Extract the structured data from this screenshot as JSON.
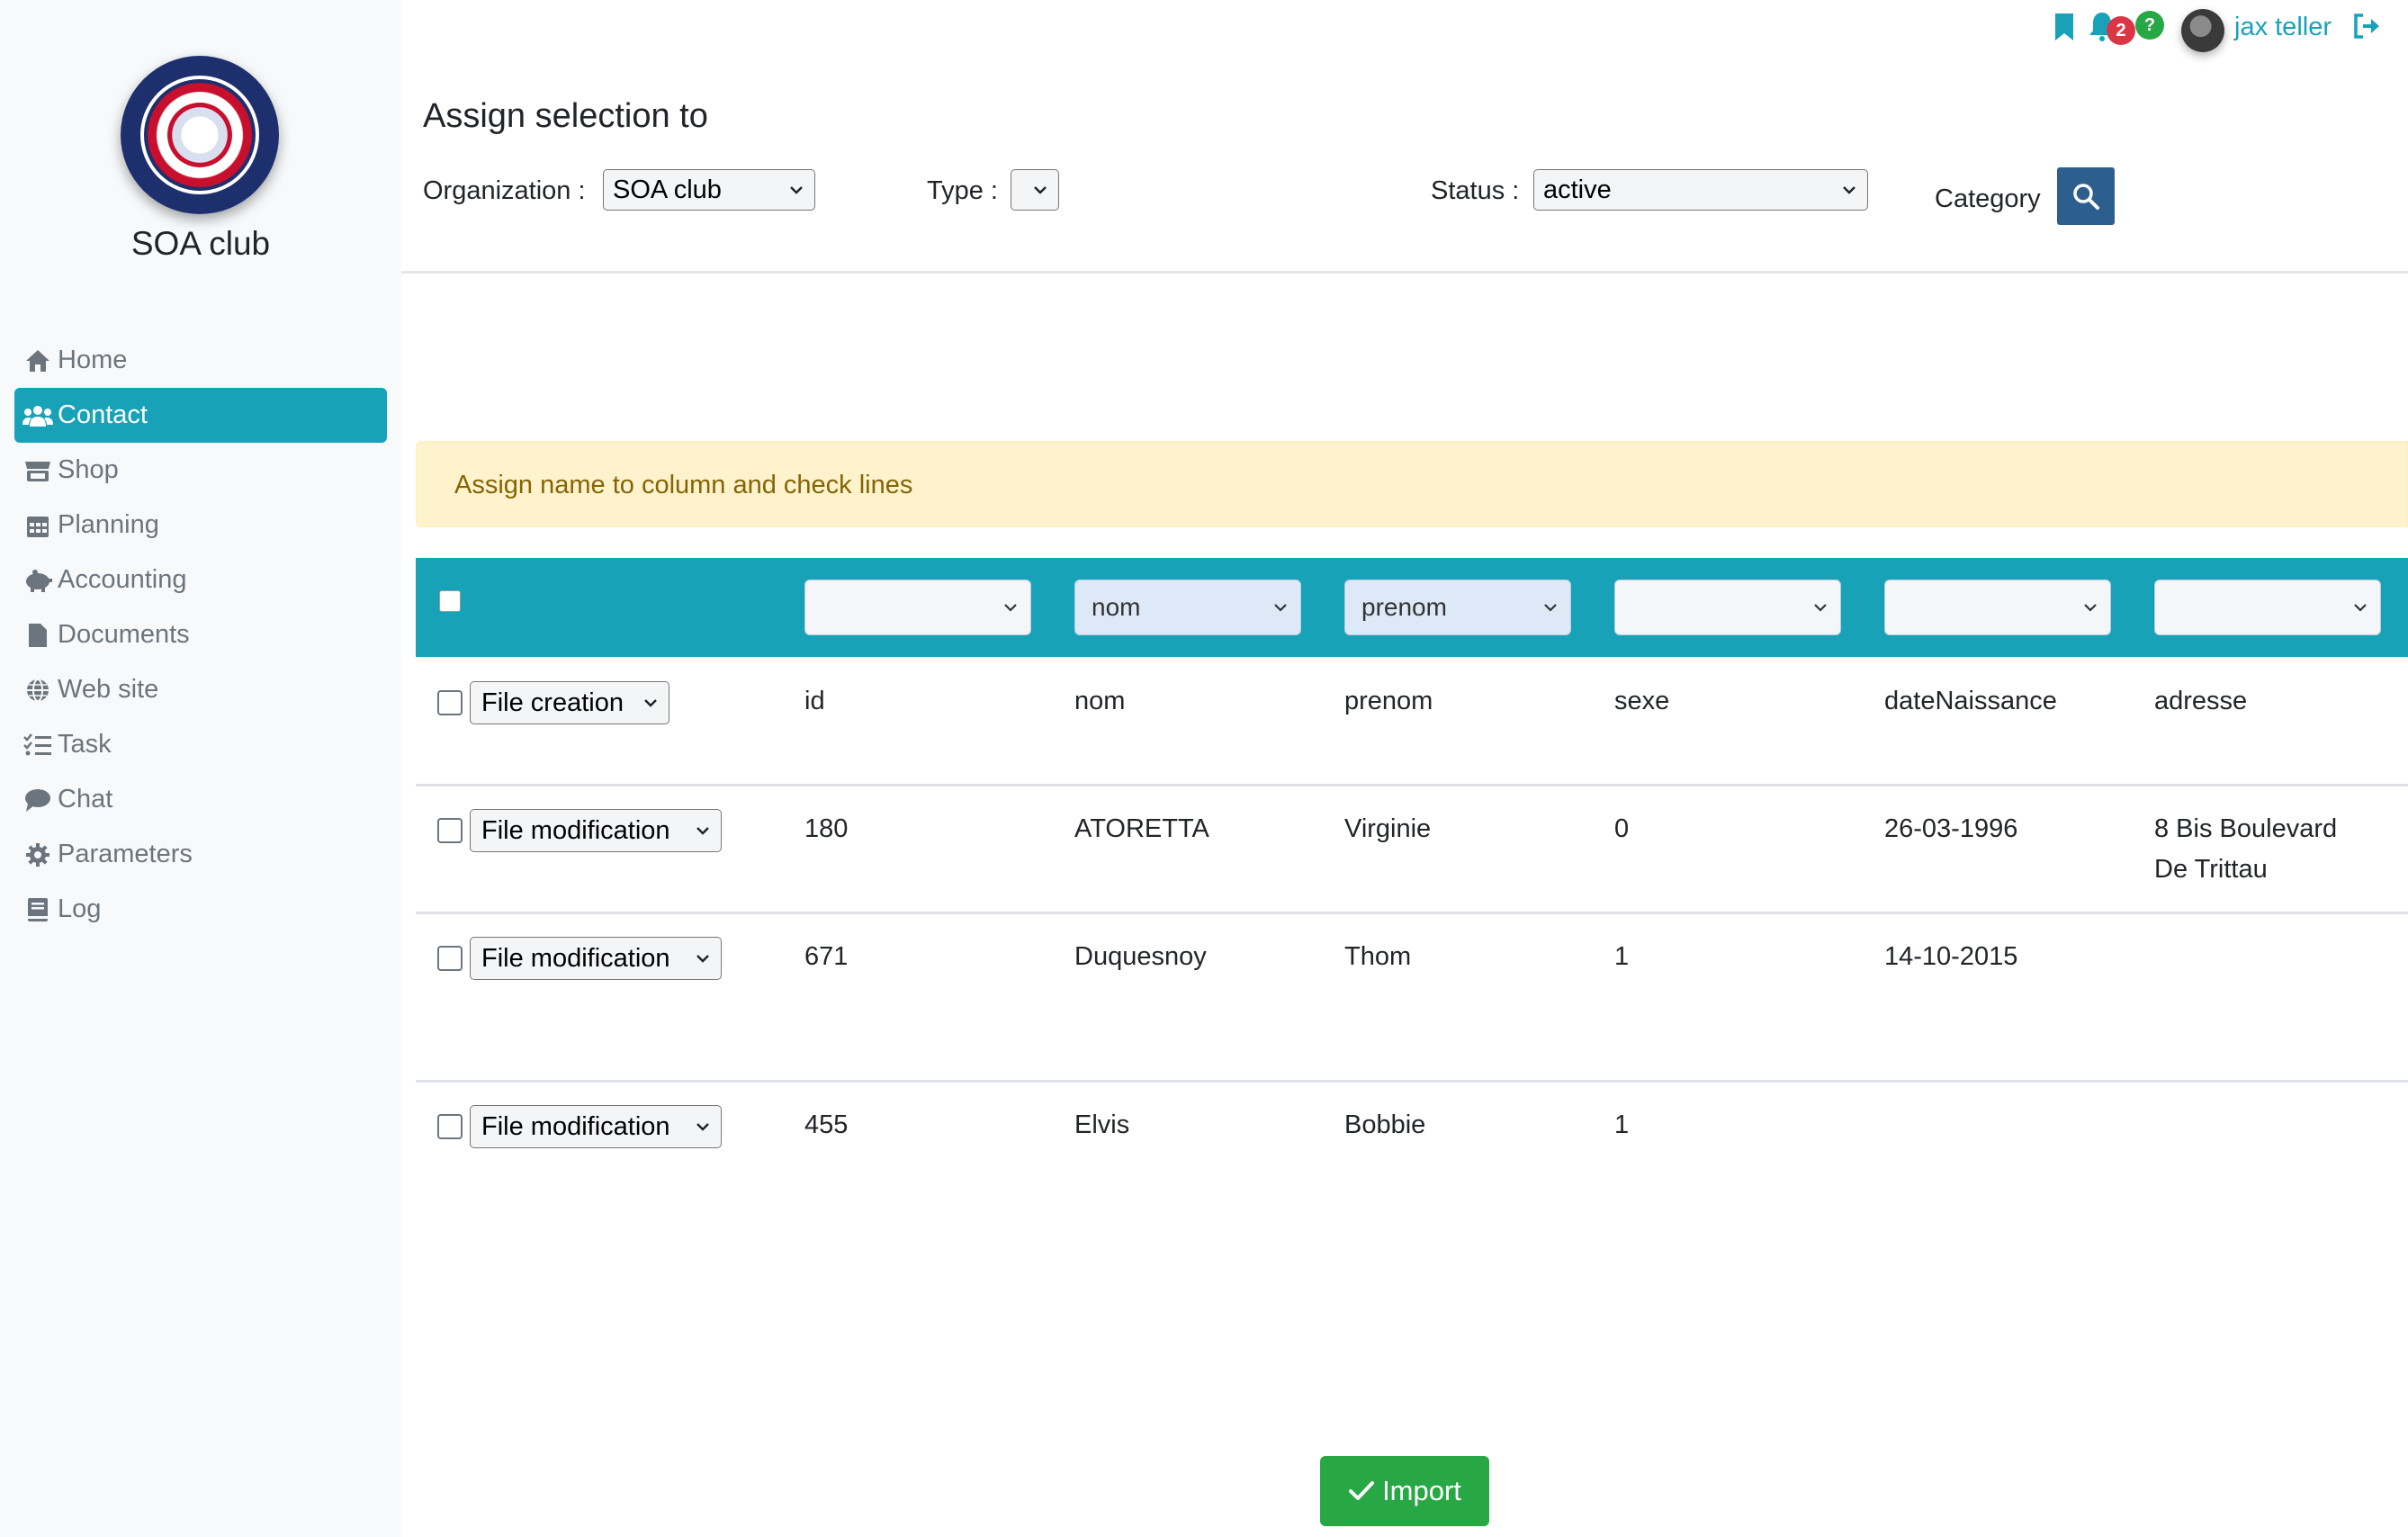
{
  "sidebar": {
    "org_name": "SOA club",
    "items": [
      {
        "label": "Home",
        "icon": "home-icon"
      },
      {
        "label": "Contact",
        "icon": "users-icon",
        "active": true
      },
      {
        "label": "Shop",
        "icon": "store-icon"
      },
      {
        "label": "Planning",
        "icon": "calendar-icon"
      },
      {
        "label": "Accounting",
        "icon": "piggy-bank-icon"
      },
      {
        "label": "Documents",
        "icon": "file-icon"
      },
      {
        "label": "Web site",
        "icon": "globe-icon"
      },
      {
        "label": "Task",
        "icon": "tasks-icon"
      },
      {
        "label": "Chat",
        "icon": "comment-icon"
      },
      {
        "label": "Parameters",
        "icon": "gear-icon"
      },
      {
        "label": "Log",
        "icon": "book-icon"
      }
    ]
  },
  "topbar": {
    "notification_count": "2",
    "help_label": "?",
    "user_name": "jax teller"
  },
  "header": {
    "title": "Assign selection to",
    "organization_label": "Organization :",
    "organization_value": "SOA club",
    "type_label": "Type :",
    "type_value": "",
    "status_label": "Status :",
    "status_value": "active",
    "category_label": "Category"
  },
  "alert": {
    "message": "Assign name to column and check lines"
  },
  "table": {
    "column_selects": [
      "",
      "nom",
      "prenom",
      "",
      "",
      ""
    ],
    "rows": [
      {
        "action": "File creation",
        "cells": [
          "id",
          "nom",
          "prenom",
          "sexe",
          "dateNaissance",
          "adresse"
        ],
        "address_line2": ""
      },
      {
        "action": "File modification",
        "cells": [
          "180",
          "ATORETTA",
          "Virginie",
          "0",
          "26-03-1996",
          "8 Bis Boulevard"
        ],
        "address_line2": "De Trittau"
      },
      {
        "action": "File modification",
        "cells": [
          "671",
          "Duquesnoy",
          "Thom",
          "1",
          "14-10-2015",
          ""
        ],
        "address_line2": ""
      },
      {
        "action": "File modification",
        "cells": [
          "455",
          "Elvis",
          "Bobbie",
          "1",
          "",
          ""
        ],
        "address_line2": ""
      }
    ]
  },
  "import_label": "Import",
  "colors": {
    "accent": "#17a2b8",
    "sidebar_bg": "#f8f9fa",
    "alert_bg": "#fff3cd",
    "alert_text": "#856404",
    "import_bg": "#28a745",
    "search_bg": "#2c5f8d",
    "badge_red": "#dc3545",
    "badge_green": "#28a745"
  }
}
